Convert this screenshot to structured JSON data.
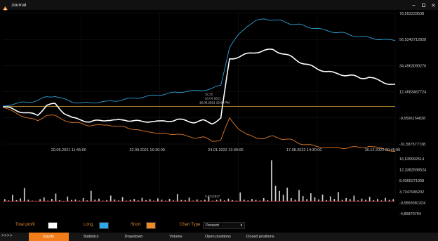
{
  "window": {
    "title": "Journal"
  },
  "chart_data": [
    {
      "type": "line",
      "title": "",
      "x_ticks": [
        "20.05.2021 11:45:00",
        "22.09.2021 16:30:00",
        "24.01.2022 13:30:00",
        "17.08.2022 14:30:00",
        "30.12.2022 20:45:00"
      ],
      "y_ticks": [
        "78,552233538",
        "56,5242712828",
        "34,4963090276",
        "12,4683467724",
        "-9,5596154828",
        "-31,587577738"
      ],
      "ylim": [
        -31.587577738,
        78.552233538
      ],
      "reference_line": {
        "value": 0,
        "color": "#e0a43a"
      },
      "crosshair_labels": [
        "32,25",
        "20.04.2021",
        "16.06.2021 15:00 PM"
      ],
      "series": [
        {
          "name": "Total profit",
          "color": "#ffffff",
          "values": [
            0,
            -2,
            -4,
            -6,
            -7,
            1,
            2,
            -5,
            -10,
            -11,
            -13,
            -12,
            -11,
            -12,
            -11,
            -12,
            -13,
            -12,
            -13,
            -12,
            -11,
            -12,
            -13,
            -12,
            -14,
            -10,
            40,
            42,
            44,
            46,
            47,
            48,
            45,
            42,
            38,
            35,
            32,
            30,
            28,
            27,
            26,
            24,
            25,
            22,
            20,
            18
          ]
        },
        {
          "name": "Long",
          "color": "#2f9fd8",
          "values": [
            0,
            2,
            3,
            4,
            5,
            8,
            9,
            6,
            4,
            3,
            3,
            4,
            4,
            5,
            6,
            7,
            8,
            9,
            10,
            11,
            12,
            13,
            13,
            14,
            15,
            18,
            50,
            60,
            68,
            72,
            74,
            73,
            72,
            70,
            69,
            67,
            66,
            64,
            63,
            62,
            60,
            59,
            58,
            57,
            56,
            56
          ]
        },
        {
          "name": "Short",
          "color": "#e07a2a",
          "values": [
            0,
            -4,
            -7,
            -10,
            -12,
            -7,
            -8,
            -11,
            -14,
            -14,
            -16,
            -16,
            -15,
            -17,
            -17,
            -19,
            -21,
            -21,
            -23,
            -23,
            -23,
            -25,
            -26,
            -26,
            -29,
            -28,
            -10,
            -18,
            -24,
            -26,
            -27,
            -25,
            -27,
            -28,
            -31,
            -32,
            -34,
            -34,
            -35,
            -35,
            -34,
            -35,
            -33,
            -35,
            -36,
            -38
          ]
        }
      ]
    },
    {
      "type": "bar",
      "title": "",
      "y_ticks": [
        "16,639992514",
        "12,3382598524",
        "8,0365271908",
        "3,7347945292",
        "-0,5669381324",
        "-4,86870794"
      ],
      "ylim": [
        -4.86870794,
        16.639992514
      ],
      "label": "0,2712937",
      "values": [
        0.8,
        0.3,
        2.5,
        0.4,
        1.1,
        5.2,
        0.6,
        0.2,
        -0.3,
        0.8,
        1.5,
        0.2,
        0.9,
        3.0,
        0.4,
        0.1,
        1.8,
        0.5,
        0.7,
        0.2,
        1.2,
        0.3,
        4.1,
        0.6,
        1.0,
        0.2,
        0.4,
        2.2,
        0.7,
        0.3,
        1.6,
        0.2,
        0.5,
        0.9,
        0.3,
        1.3,
        0.4,
        0.8,
        0.2,
        1.1,
        0.6,
        0.2,
        0.9,
        0.3,
        2.8,
        0.5,
        0.4,
        1.4,
        0.2,
        0.7,
        0.3,
        0.6,
        1.9,
        0.2,
        0.5,
        0.8,
        0.3,
        1.0,
        0.4,
        0.2,
        3.4,
        0.6,
        0.3,
        0.9,
        0.5,
        0.2,
        1.2,
        0.4,
        16.0,
        6.0,
        4.0,
        2.5,
        5.3,
        1.2,
        0.6,
        4.4,
        2.0,
        0.8,
        3.1,
        1.5,
        0.7,
        2.6,
        0.4,
        1.9,
        0.9,
        3.6,
        0.5,
        1.2,
        0.8,
        2.2,
        0.3,
        1.0,
        0.6,
        1.7,
        0.4,
        0.9,
        0.3,
        1.3,
        0.5,
        0.8
      ]
    }
  ],
  "controls": {
    "total_profit_label": "Total profit",
    "total_profit_color": "#ffffff",
    "long_label": "Long",
    "long_color": "#2ea8e8",
    "short_label": "Short",
    "short_color": "#f08a24",
    "chart_type_label": "Chart Type",
    "chart_type_value": "Persent"
  },
  "tabs": {
    "arrows": ">>>>",
    "items": [
      "Equity",
      "Statistics",
      "Drawdown",
      "Volume",
      "Open positions",
      "Closed positions"
    ],
    "active": "Equity"
  }
}
